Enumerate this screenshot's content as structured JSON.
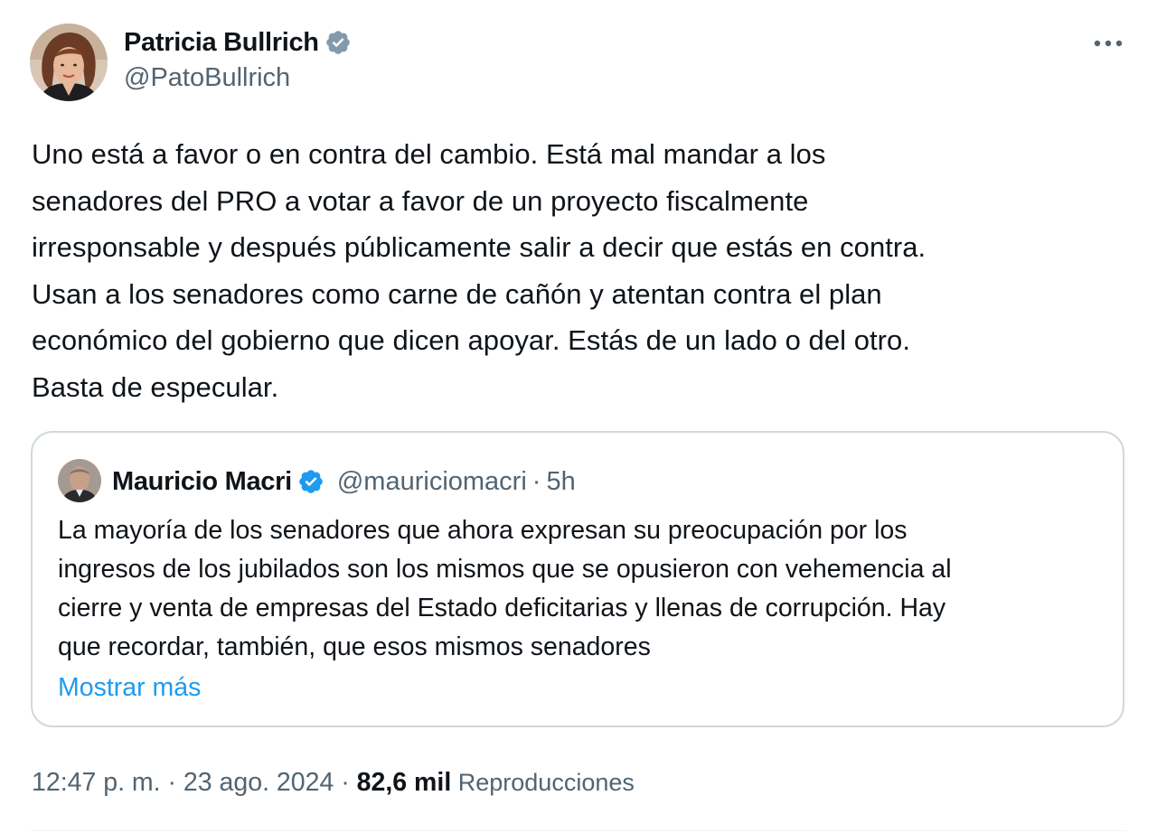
{
  "tweet": {
    "author": {
      "name": "Patricia Bullrich",
      "handle": "@PatoBullrich",
      "verified_color": "#829aab",
      "avatar_icon": "portrait-avatar"
    },
    "more_icon": "more-horizontal-icon",
    "text": "Uno está a favor o en contra del cambio. Está mal mandar a los\nsenadores del PRO a votar a favor de un proyecto fiscalmente\nirresponsable y después públicamente salir a decir que estás en contra.\nUsan a los senadores como carne de cañón y atentan contra el plan\neconómico del gobierno que dicen apoyar. Estás de un lado o del otro.\nBasta de especular.",
    "quote": {
      "author_name": "Mauricio Macri",
      "author_handle": "@mauriciomacri",
      "separator": "·",
      "time": "5h",
      "verified_color": "#1d9bf0",
      "text": "La mayoría de los senadores que ahora expresan su preocupación por los\ningresos de los jubilados son los mismos que se opusieron con vehemencia al\ncierre y venta de empresas del Estado deficitarias y llenas de corrupción. Hay\nque recordar, también, que esos mismos senadores",
      "show_more": "Mostrar más"
    },
    "meta": {
      "time": "12:47 p. m.",
      "sep1": " · ",
      "date": "23 ago. 2024",
      "sep2": " · ",
      "views_count": "82,6 mil",
      "views_label": " Reproducciones"
    },
    "colors": {
      "text": "#0f1419",
      "secondary": "#536471",
      "link": "#1d9bf0",
      "border": "#cfd9de"
    }
  }
}
